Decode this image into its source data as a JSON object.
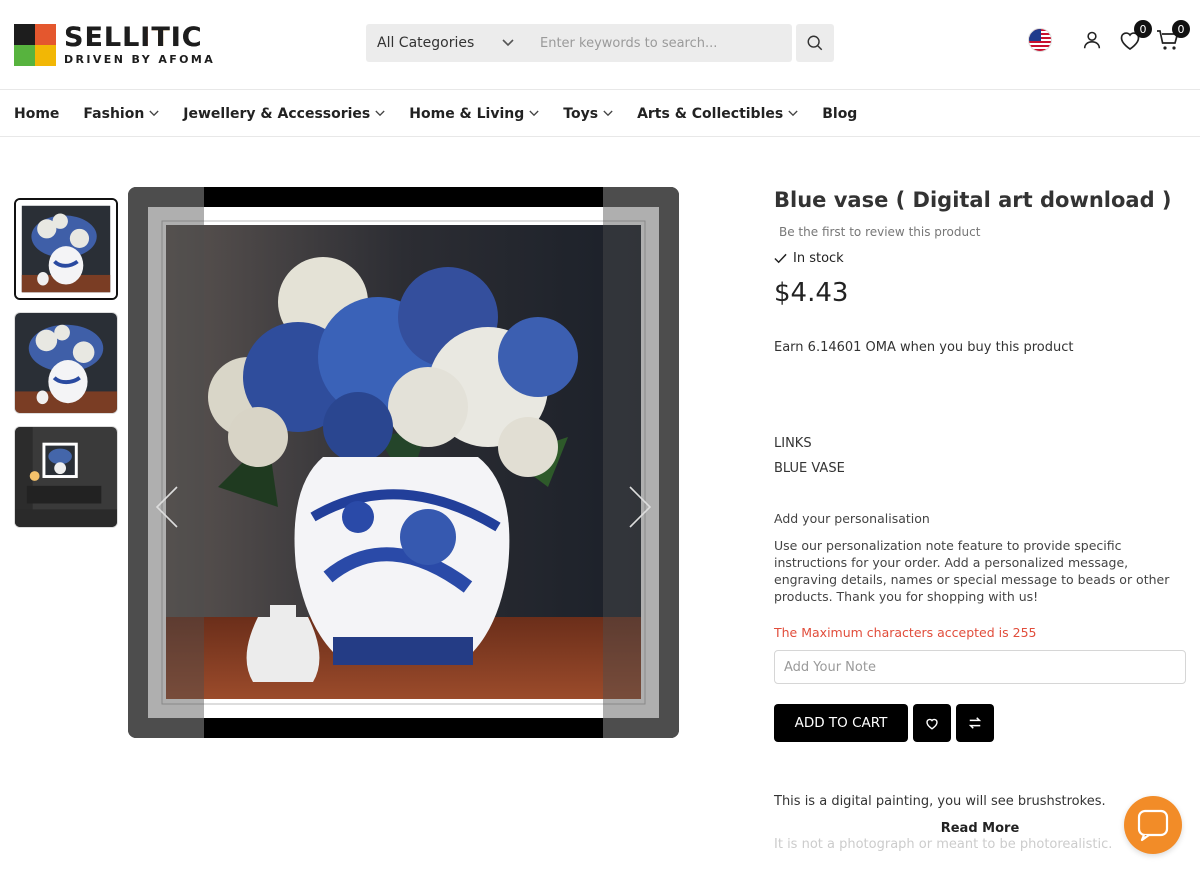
{
  "brand": {
    "name": "SELLITIC",
    "tagline": "DRIVEN BY AFOMA"
  },
  "search": {
    "category": "All Categories",
    "placeholder": "Enter keywords to search..."
  },
  "header": {
    "wishlist_count": "0",
    "cart_count": "0",
    "flag": "us-flag-icon"
  },
  "nav": {
    "items": [
      {
        "label": "Home",
        "dropdown": false
      },
      {
        "label": "Fashion",
        "dropdown": true
      },
      {
        "label": "Jewellery & Accessories",
        "dropdown": true
      },
      {
        "label": "Home & Living",
        "dropdown": true
      },
      {
        "label": "Toys",
        "dropdown": true
      },
      {
        "label": "Arts & Collectibles",
        "dropdown": true
      },
      {
        "label": "Blog",
        "dropdown": false
      }
    ]
  },
  "product": {
    "title": "Blue vase ( Digital art download )",
    "review_text": "Be the first to review this product",
    "stock": "In stock",
    "price": "$4.43",
    "earn": "Earn 6.14601 OMA when you buy this product",
    "links_label": "LINKS",
    "link_item": "BLUE VASE",
    "personalisation_title": "Add your personalisation",
    "personalisation_text": "Use our personalization note feature to provide specific instructions for your order. Add a personalized message, engraving details, names or special message to beads or other products. Thank you for shopping with us!",
    "max_chars": "The Maximum characters accepted is 255",
    "note_placeholder": "Add Your Note",
    "add_to_cart": "ADD TO CART",
    "description": "This is a digital painting, you will see brushstrokes.",
    "read_more": "Read More",
    "description_more": "It is not a photograph or meant to be photorealistic."
  },
  "colors": {
    "accent": "#e14d3b",
    "chat": "#f28c28",
    "button": "#000000"
  }
}
